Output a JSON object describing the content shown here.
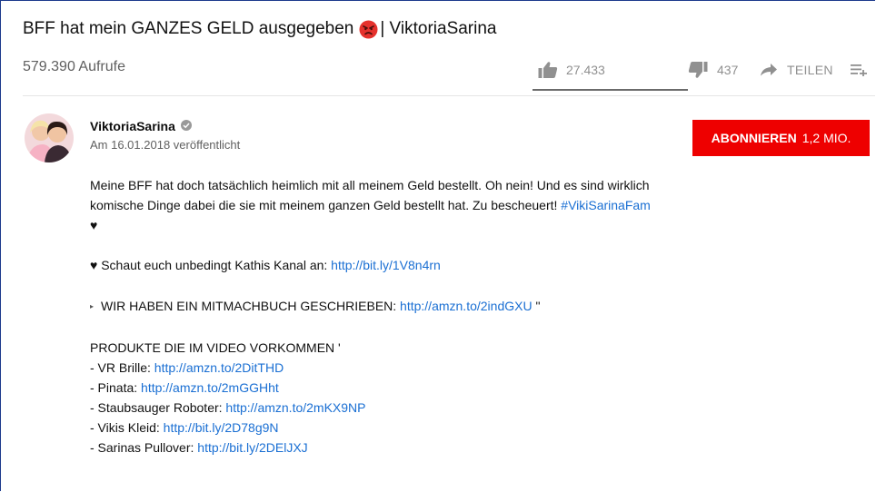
{
  "video": {
    "title": "BFF hat mein GANZES GELD ausgegeben",
    "title_suffix": "| ViktoriaSarina",
    "title_emoji": "angry-face-emoji",
    "views": "579.390 Aufrufe"
  },
  "actions": {
    "likes": "27.433",
    "dislikes": "437",
    "share_label": "TEILEN"
  },
  "channel": {
    "name": "ViktoriaSarina",
    "published": "Am 16.01.2018 veröffentlicht",
    "subscribe_label": "ABONNIEREN",
    "subscriber_count": "1,2 MIO."
  },
  "description": {
    "line1": "Meine BFF hat doch tatsächlich heimlich mit all meinem Geld bestellt. Oh nein! Und es sind wirklich",
    "line2": "komische Dinge dabei die sie mit meinem ganzen Geld bestellt hat. Zu bescheuert!",
    "hashtag": "#VikiSarinaFam",
    "heart": "♥",
    "kathi_text": "♥ Schaut euch unbedingt Kathis Kanal an:",
    "kathi_link": "http://bit.ly/1V8n4rn",
    "book_marker": "▸",
    "book_text": "WIR HABEN EIN MITMACHBUCH GESCHRIEBEN:",
    "book_link": "http://amzn.to/2indGXU",
    "book_suffix": " \"",
    "products_heading": "PRODUKTE DIE IM VIDEO VORKOMMEN '",
    "products": [
      {
        "label": "- VR Brille:",
        "link": "http://amzn.to/2DitTHD"
      },
      {
        "label": "- Pinata:",
        "link": "http://amzn.to/2mGGHht"
      },
      {
        "label": "- Staubsauger Roboter:",
        "link": "http://amzn.to/2mKX9NP"
      },
      {
        "label": "- Vikis Kleid:",
        "link": "http://bit.ly/2D78g9N"
      },
      {
        "label": "- Sarinas Pullover:",
        "link": "http://bit.ly/2DElJXJ"
      }
    ]
  },
  "colors": {
    "subscribe_red": "#ee0000",
    "link_blue": "#1a6fd3",
    "frame_border": "#1d3a8c"
  },
  "icons": [
    "thumbs-up-icon",
    "thumbs-down-icon",
    "share-arrow-icon",
    "add-to-playlist-icon",
    "more-dots-icon",
    "verified-check-icon"
  ]
}
